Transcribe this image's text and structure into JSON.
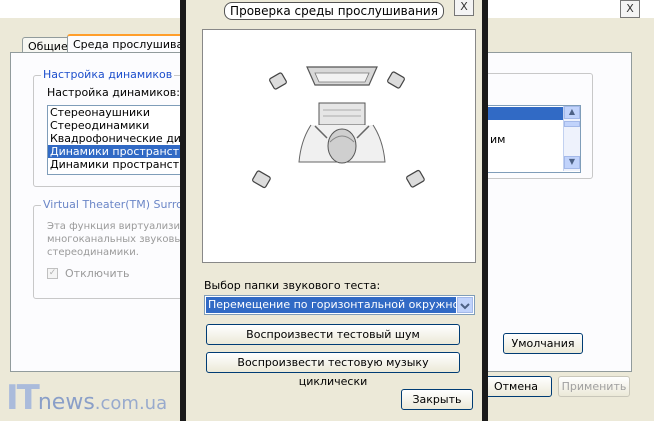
{
  "background_window": {
    "close_glyph": "X",
    "tabs": [
      "Общие",
      "Среда прослушивания"
    ],
    "speaker_group": {
      "title": "Настройка динамиков",
      "label": "Настройка динамиков:",
      "items": [
        "Стереонаушники",
        "Стереодинамики",
        "Квадрофонические динамики",
        "Динамики пространственного звучания",
        "Динамики пространственного звучания"
      ],
      "selected_index": 3
    },
    "virtual_group": {
      "title": "Virtual Theater(TM) Surround",
      "description": [
        "Эта функция виртуализирует",
        "многоканальных звуковых",
        "стереодинамики."
      ],
      "checkbox_label": "Отключить"
    },
    "right_list": {
      "item2": "им"
    },
    "buttons": {
      "defaults": "Умолчания",
      "cancel": "Отмена",
      "apply": "Применить"
    }
  },
  "dialog": {
    "title": "Проверка среды прослушивания",
    "close_glyph": "X",
    "folder_label": "Выбор папки звукового теста:",
    "folder_value": "Перемещение по горизонтальной окружности",
    "play_noise": "Воспроизвести тестовый шум",
    "play_music_loop": "Воспроизвести тестовую музыку циклически",
    "close_button": "Закрыть"
  },
  "watermark": {
    "part1": "IT",
    "part2": "news",
    "part3": ".com.ua"
  },
  "colors": {
    "selection": "#316ac5",
    "window": "#ece9d8",
    "frame": "#1a1a1a",
    "group_title": "#1d4fcc"
  }
}
